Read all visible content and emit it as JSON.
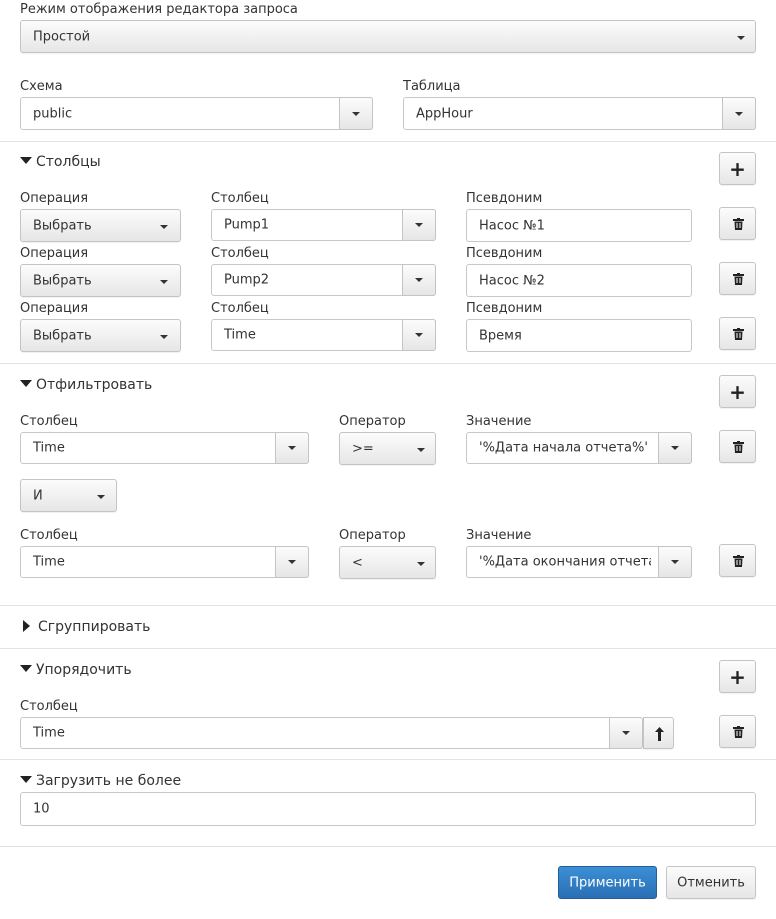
{
  "editor_mode": {
    "label": "Режим отображения редактора запроса",
    "value": "Простой"
  },
  "schema": {
    "label": "Схема",
    "value": "public"
  },
  "table": {
    "label": "Таблица",
    "value": "AppHour"
  },
  "columns_section": {
    "title": "Столбцы",
    "op_label": "Операция",
    "col_label": "Столбец",
    "alias_label": "Псевдоним",
    "rows": [
      {
        "operation": "Выбрать",
        "column": "Pump1",
        "alias": "Насос №1"
      },
      {
        "operation": "Выбрать",
        "column": "Pump2",
        "alias": "Насос №2"
      },
      {
        "operation": "Выбрать",
        "column": "Time",
        "alias": "Время"
      }
    ]
  },
  "filter_section": {
    "title": "Отфильтровать",
    "col_label": "Столбец",
    "operator_label": "Оператор",
    "value_label": "Значение",
    "rows": [
      {
        "column": "Time",
        "operator": ">=",
        "value": "'%Дата начала отчета%'"
      },
      {
        "column": "Time",
        "operator": "<",
        "value": "'%Дата окончания отчета%'"
      }
    ],
    "conjunction": "И"
  },
  "group_section": {
    "title": "Сгруппировать"
  },
  "order_section": {
    "title": "Упорядочить",
    "col_label": "Столбец",
    "column": "Time"
  },
  "limit_section": {
    "title": "Загрузить не более",
    "value": "10"
  },
  "footer": {
    "apply_label": "Применить",
    "cancel_label": "Отменить"
  },
  "colors": {
    "primary": "#2f7cc6",
    "border": "#c8c8c8"
  }
}
